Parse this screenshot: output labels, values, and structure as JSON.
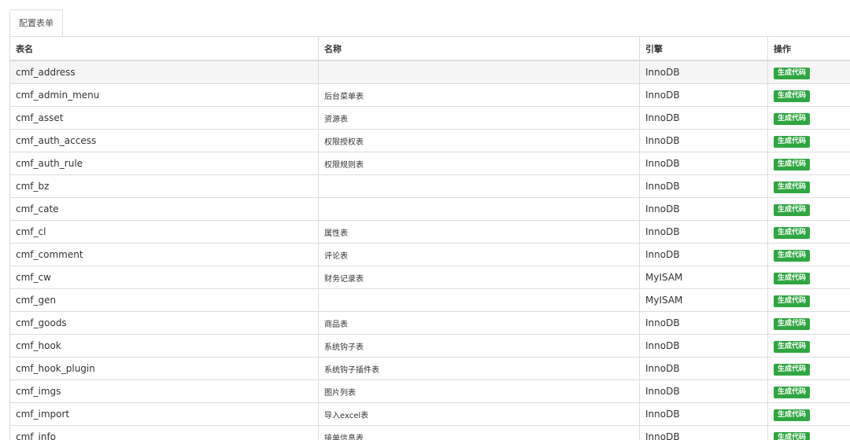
{
  "tabs": [
    {
      "label": "配置表单"
    }
  ],
  "table": {
    "headers": {
      "table_name": "表名",
      "display_name": "名称",
      "engine": "引擎",
      "action": "操作"
    },
    "action_label": "生成代码",
    "rows": [
      {
        "table": "cmf_address",
        "name": "",
        "engine": "InnoDB",
        "action": "生成代码"
      },
      {
        "table": "cmf_admin_menu",
        "name": "后台菜单表",
        "engine": "InnoDB",
        "action": "生成代码"
      },
      {
        "table": "cmf_asset",
        "name": "资源表",
        "engine": "InnoDB",
        "action": "生成代码"
      },
      {
        "table": "cmf_auth_access",
        "name": "权限授权表",
        "engine": "InnoDB",
        "action": "生成代码"
      },
      {
        "table": "cmf_auth_rule",
        "name": "权限规则表",
        "engine": "InnoDB",
        "action": "生成代码"
      },
      {
        "table": "cmf_bz",
        "name": "",
        "engine": "InnoDB",
        "action": "生成代码"
      },
      {
        "table": "cmf_cate",
        "name": "",
        "engine": "InnoDB",
        "action": "生成代码"
      },
      {
        "table": "cmf_cl",
        "name": "属性表",
        "engine": "InnoDB",
        "action": "生成代码"
      },
      {
        "table": "cmf_comment",
        "name": "评论表",
        "engine": "InnoDB",
        "action": "生成代码"
      },
      {
        "table": "cmf_cw",
        "name": "财务记录表",
        "engine": "MyISAM",
        "action": "生成代码"
      },
      {
        "table": "cmf_gen",
        "name": "",
        "engine": "MyISAM",
        "action": "生成代码"
      },
      {
        "table": "cmf_goods",
        "name": "商品表",
        "engine": "InnoDB",
        "action": "生成代码"
      },
      {
        "table": "cmf_hook",
        "name": "系统钩子表",
        "engine": "InnoDB",
        "action": "生成代码"
      },
      {
        "table": "cmf_hook_plugin",
        "name": "系统钩子插件表",
        "engine": "InnoDB",
        "action": "生成代码"
      },
      {
        "table": "cmf_imgs",
        "name": "图片列表",
        "engine": "InnoDB",
        "action": "生成代码"
      },
      {
        "table": "cmf_import",
        "name": "导入excel表",
        "engine": "InnoDB",
        "action": "生成代码"
      },
      {
        "table": "cmf_info",
        "name": "接单信息表",
        "engine": "InnoDB",
        "action": "生成代码"
      }
    ]
  },
  "colors": {
    "action_button": "#2fa641",
    "border": "#dddddd",
    "hover_row": "#f5f5f5"
  }
}
